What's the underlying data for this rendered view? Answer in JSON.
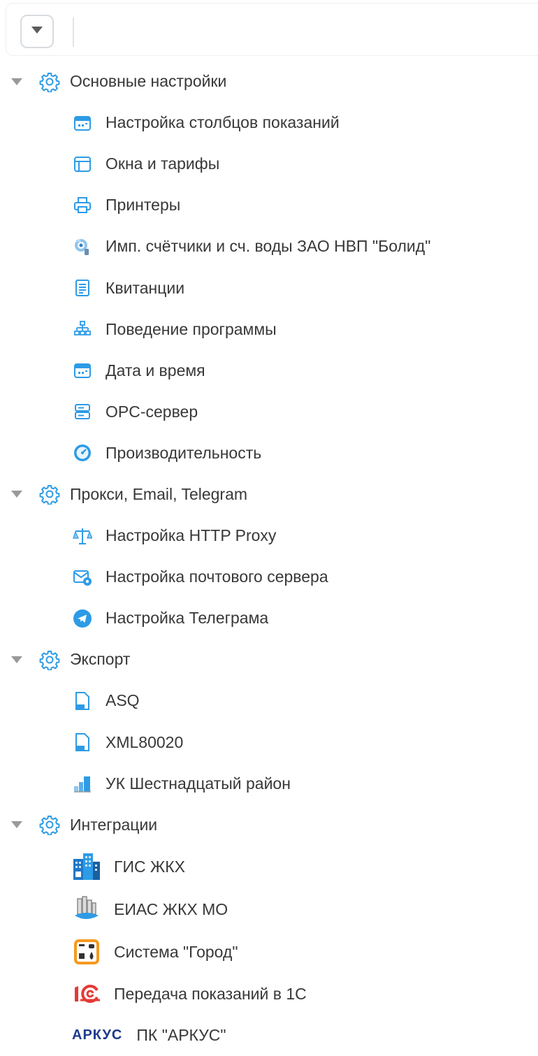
{
  "colors": {
    "accent": "#2d9be6",
    "caret": "#9a9a9a",
    "text": "#383838"
  },
  "toolbar": {
    "dropdown_icon": "caret-down-icon"
  },
  "tree": {
    "groups": [
      {
        "label": "Основные настройки",
        "icon": "gear-icon",
        "items": [
          {
            "label": "Настройка столбцов показаний",
            "icon": "calendar-icon"
          },
          {
            "label": "Окна и тарифы",
            "icon": "window-icon"
          },
          {
            "label": "Принтеры",
            "icon": "printer-icon"
          },
          {
            "label": "Имп. счётчики и сч. воды ЗАО НВП \"Болид\"",
            "icon": "meter-icon"
          },
          {
            "label": "Квитанции",
            "icon": "receipt-icon"
          },
          {
            "label": "Поведение программы",
            "icon": "hierarchy-icon"
          },
          {
            "label": "Дата и время",
            "icon": "calendar-icon"
          },
          {
            "label": "OPC-сервер",
            "icon": "server-icon"
          },
          {
            "label": "Производительность",
            "icon": "speedometer-icon"
          }
        ]
      },
      {
        "label": "Прокси, Email, Telegram",
        "icon": "gear-icon",
        "items": [
          {
            "label": "Настройка HTTP Proxy",
            "icon": "scales-icon"
          },
          {
            "label": "Настройка почтового сервера",
            "icon": "mail-settings-icon"
          },
          {
            "label": "Настройка Телеграма",
            "icon": "telegram-icon"
          }
        ]
      },
      {
        "label": "Экспорт",
        "icon": "gear-icon",
        "items": [
          {
            "label": "ASQ",
            "icon": "asq-file-icon"
          },
          {
            "label": "XML80020",
            "icon": "xml-file-icon"
          },
          {
            "label": "УК Шестнадцатый район",
            "icon": "building-chart-icon"
          }
        ]
      },
      {
        "label": "Интеграции",
        "icon": "gear-icon",
        "items": [
          {
            "label": "ГИС ЖКХ",
            "icon": "gis-building-icon"
          },
          {
            "label": "ЕИАС ЖКХ МО",
            "icon": "eias-icon"
          },
          {
            "label": "Система \"Город\"",
            "icon": "gorod-icon"
          },
          {
            "label": "Передача показаний в 1С",
            "icon": "1c-logo-icon"
          },
          {
            "label": "ПК \"АРКУС\"",
            "icon": "arkus-logo-icon",
            "logo_text": "АРКУС"
          }
        ]
      }
    ]
  }
}
